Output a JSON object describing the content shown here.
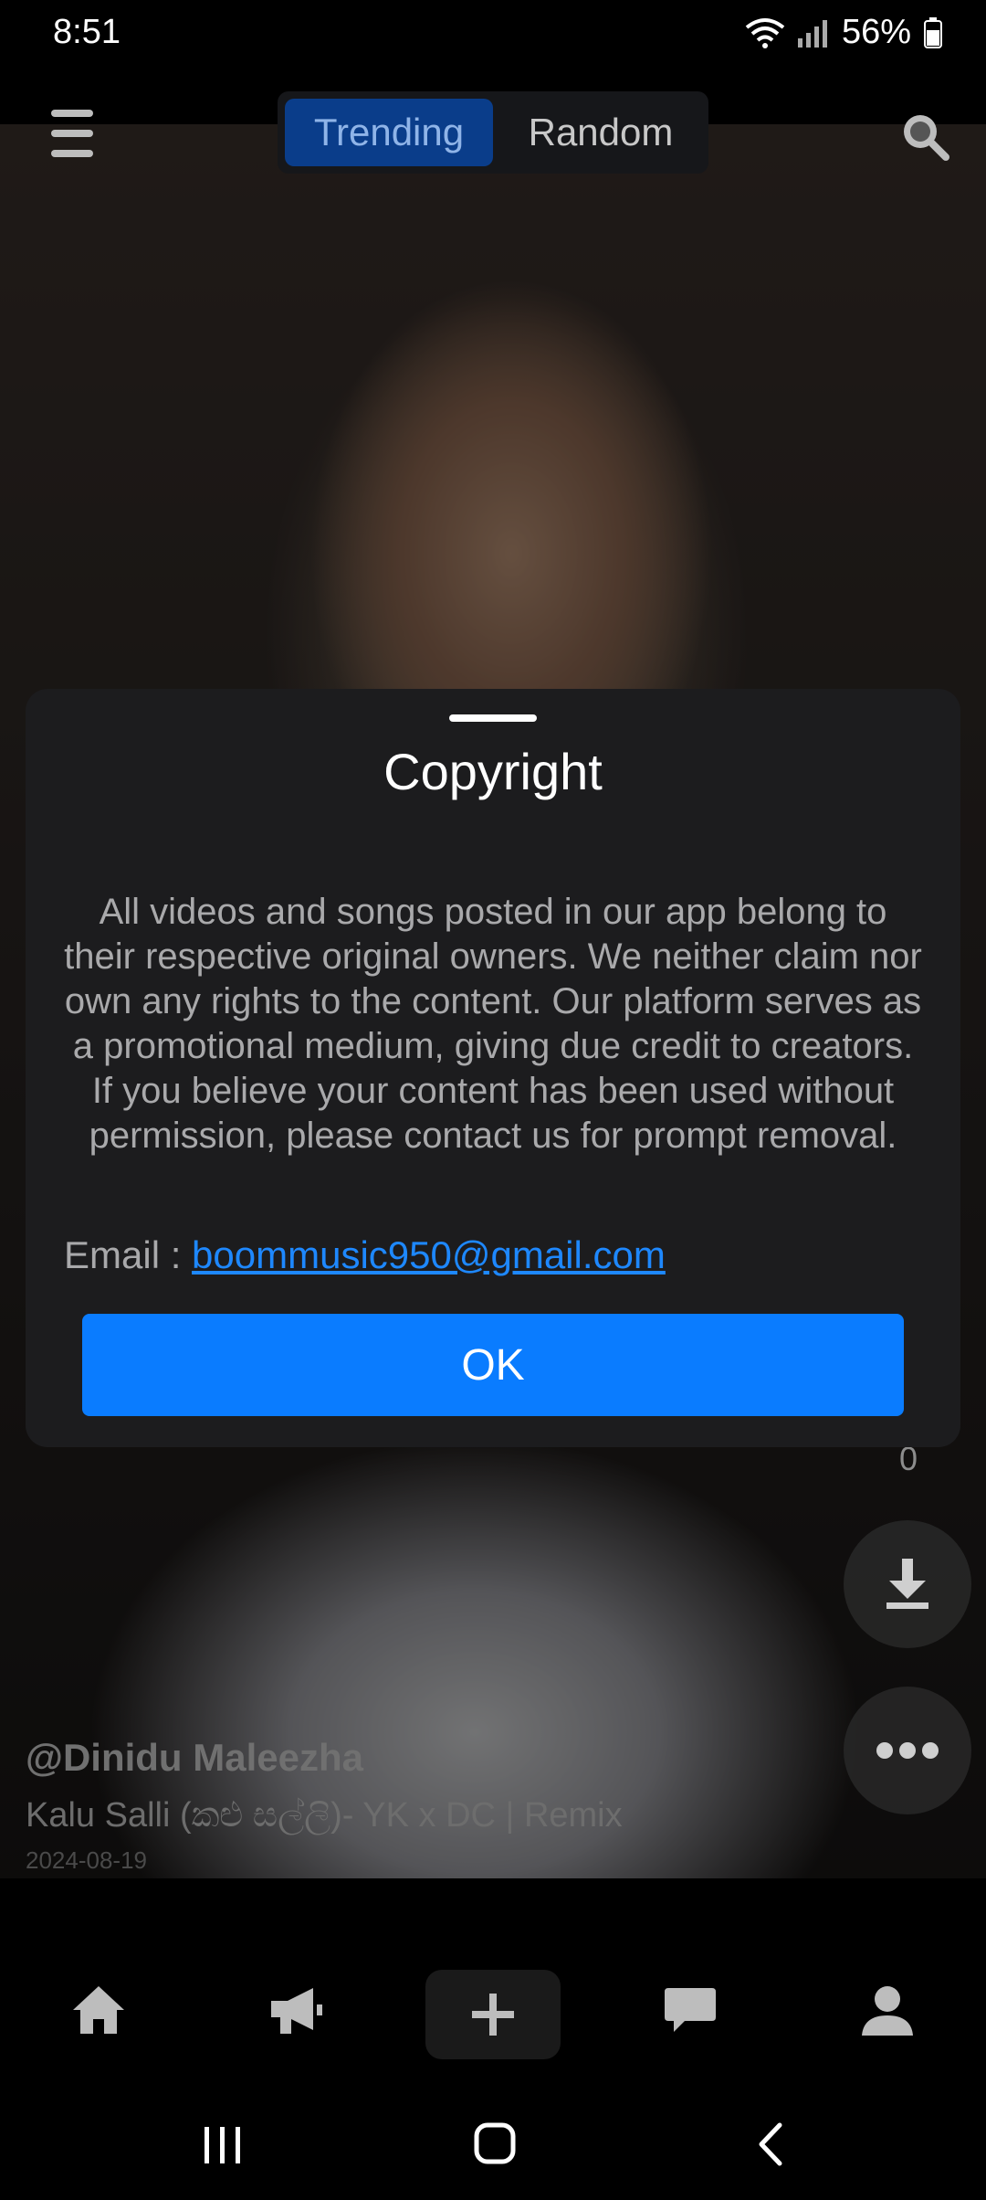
{
  "status_bar": {
    "time": "8:51",
    "battery": "56%"
  },
  "tabs": [
    {
      "label": "Trending"
    },
    {
      "label": "Random"
    }
  ],
  "video": {
    "username": "@Dinidu Maleezha",
    "title": "Kalu Salli (කළු සල්ලි)- YK x DC | Remix",
    "date": "2024-08-19",
    "count": "0"
  },
  "modal": {
    "title": "Copyright",
    "body": "All videos and songs posted in our app belong to their respective original owners. We neither claim nor own any rights to the content. Our platform serves as a promotional medium, giving due credit to creators. If you believe your content has been used without permission, please contact us for prompt removal.",
    "email_label": "Email : ",
    "email": "boommusic950@gmail.com",
    "ok_label": "OK"
  },
  "colors": {
    "accent": "#0a7cff",
    "link": "#1e88ff",
    "modal_bg": "#1c1c1e",
    "active_tab": "#0a3d8a"
  },
  "icons": [
    "menu-icon",
    "search-icon",
    "download-icon",
    "more-icon",
    "home-icon",
    "megaphone-icon",
    "plus-icon",
    "chat-icon",
    "profile-icon",
    "wifi-icon",
    "signal-icon",
    "battery-icon",
    "recents-icon",
    "home-button-icon",
    "back-icon"
  ]
}
